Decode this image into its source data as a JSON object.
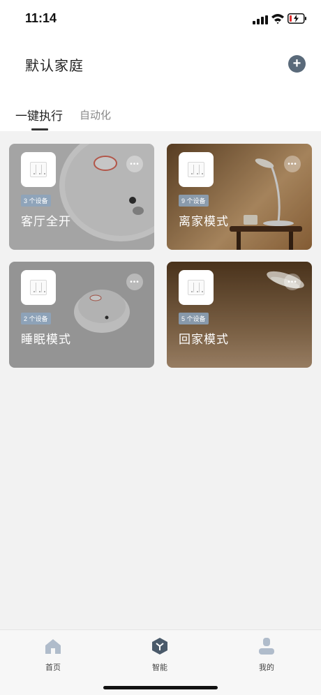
{
  "status_bar": {
    "time": "11:14"
  },
  "header": {
    "home_title": "默认家庭"
  },
  "tabs": [
    {
      "label": "一键执行",
      "active": true
    },
    {
      "label": "自动化",
      "active": false
    }
  ],
  "scenes": [
    {
      "name": "客厅全开",
      "device_count": "3 个设备",
      "more": "•••"
    },
    {
      "name": "离家模式",
      "device_count": "9 个设备",
      "more": "•••"
    },
    {
      "name": "睡眠模式",
      "device_count": "2 个设备",
      "more": "•••"
    },
    {
      "name": "回家模式",
      "device_count": "5 个设备",
      "more": "•••"
    }
  ],
  "bottom_nav": [
    {
      "label": "首页",
      "icon": "home-icon"
    },
    {
      "label": "智能",
      "icon": "smart-cube-icon",
      "active": true
    },
    {
      "label": "我的",
      "icon": "profile-icon"
    }
  ],
  "colors": {
    "accent": "#5a6a7a",
    "badge": "#8ca5be"
  }
}
